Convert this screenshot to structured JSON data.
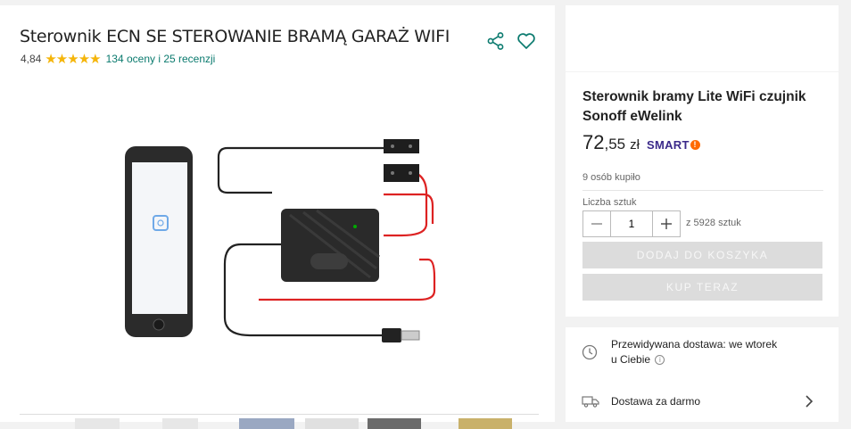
{
  "product": {
    "title": "Sterownik ECN SE STEROWANIE BRAMĄ GARAŻ WIFI",
    "rating": "4,84",
    "stars": "★★★★★",
    "reviews_link": "134 oceny i 25 recenzji",
    "icons": [
      "share-icon",
      "heart-icon"
    ]
  },
  "offer": {
    "title": "Sterownik bramy Lite WiFi czujnik Sonoff eWelink",
    "price_int": "72",
    "price_dec": ",55",
    "currency": "zł",
    "badge": "SMART",
    "bought": "9 osób kupiło",
    "qty_label": "Liczba sztuk",
    "qty_value": "1",
    "stock": "z 5928 sztuk",
    "add_to_cart": "DODAJ DO KOSZYKA",
    "buy_now": "KUP TERAZ",
    "button_color": "#dcdcdc"
  },
  "delivery": {
    "expected_line1": "Przewidywana dostawa: we wtorek",
    "expected_line2": "u Ciebie",
    "info_glyph": "i",
    "free_shipping": "Dostawa za darmo"
  },
  "colors": {
    "accent": "#0a7a6e",
    "star": "#f5b50a",
    "smart": "#3b2a8a",
    "smart_dot": "#ff6a00"
  }
}
